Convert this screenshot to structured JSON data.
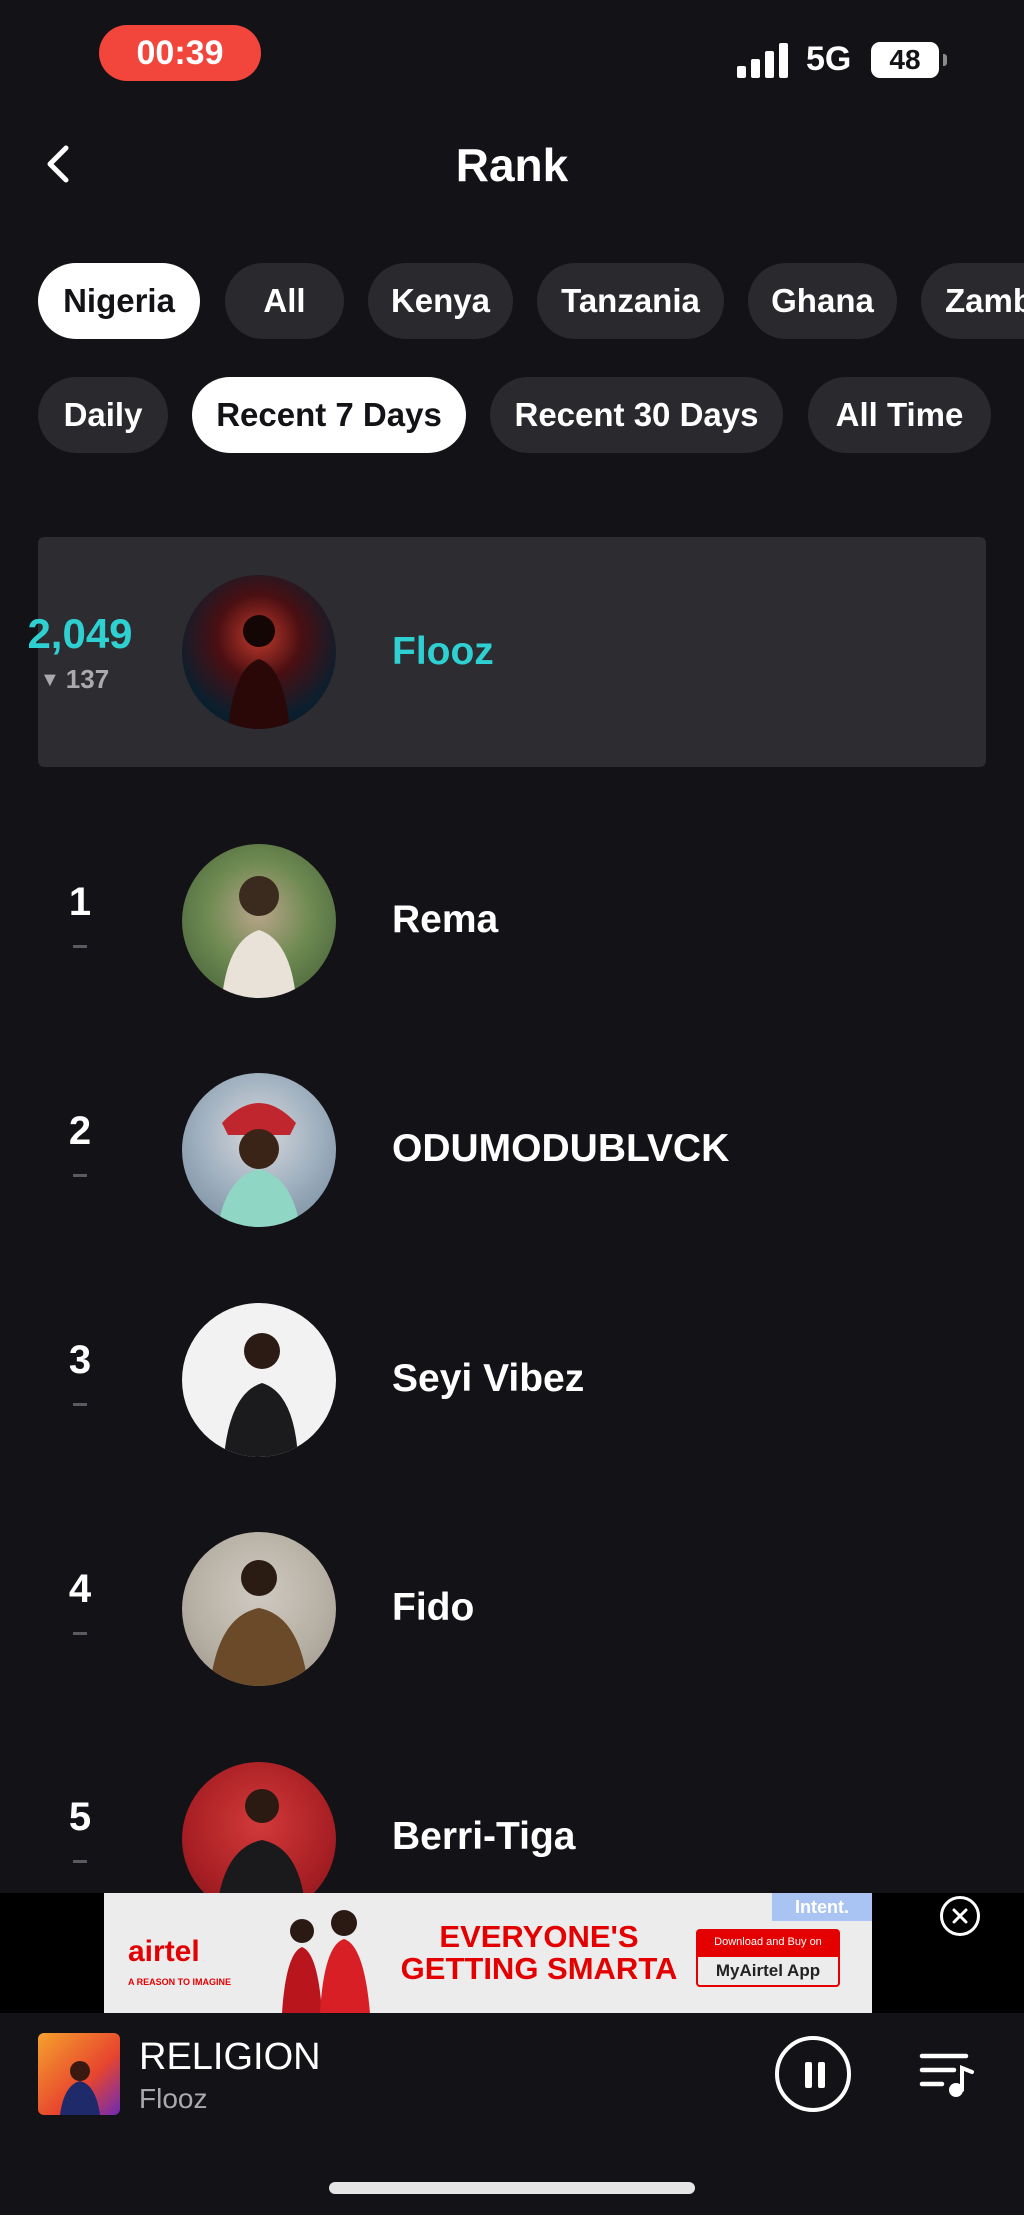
{
  "status_bar": {
    "time": "00:39",
    "network": "5G",
    "battery": "48"
  },
  "header": {
    "title": "Rank"
  },
  "region_tabs": [
    {
      "label": "Nigeria",
      "active": true
    },
    {
      "label": "All",
      "active": false
    },
    {
      "label": "Kenya",
      "active": false
    },
    {
      "label": "Tanzania",
      "active": false
    },
    {
      "label": "Ghana",
      "active": false
    },
    {
      "label": "Zamb",
      "active": false
    }
  ],
  "period_tabs": [
    {
      "label": "Daily",
      "active": false
    },
    {
      "label": "Recent 7 Days",
      "active": true
    },
    {
      "label": "Recent 30 Days",
      "active": false
    },
    {
      "label": "All Time",
      "active": false
    }
  ],
  "current_artist": {
    "rank": "2,049",
    "change": "137",
    "name": "Flooz"
  },
  "rankings": [
    {
      "rank": "1",
      "name": "Rema"
    },
    {
      "rank": "2",
      "name": "ODUMODUBLVCK"
    },
    {
      "rank": "3",
      "name": "Seyi Vibez"
    },
    {
      "rank": "4",
      "name": "Fido"
    },
    {
      "rank": "5",
      "name": "Berri-Tiga"
    }
  ],
  "ad": {
    "brand": "airtel",
    "tagline": "A REASON TO IMAGINE",
    "headline": "EVERYONE'S GETTING SMARTA",
    "download_text": "Download and Buy on",
    "cta": "MyAirtel App",
    "badge": "Intent."
  },
  "player": {
    "title": "RELIGION",
    "artist": "Flooz"
  },
  "colors": {
    "accent": "#2fd0d2",
    "background": "#131216",
    "time_pill": "#f2453c",
    "ad_red": "#e40000"
  }
}
